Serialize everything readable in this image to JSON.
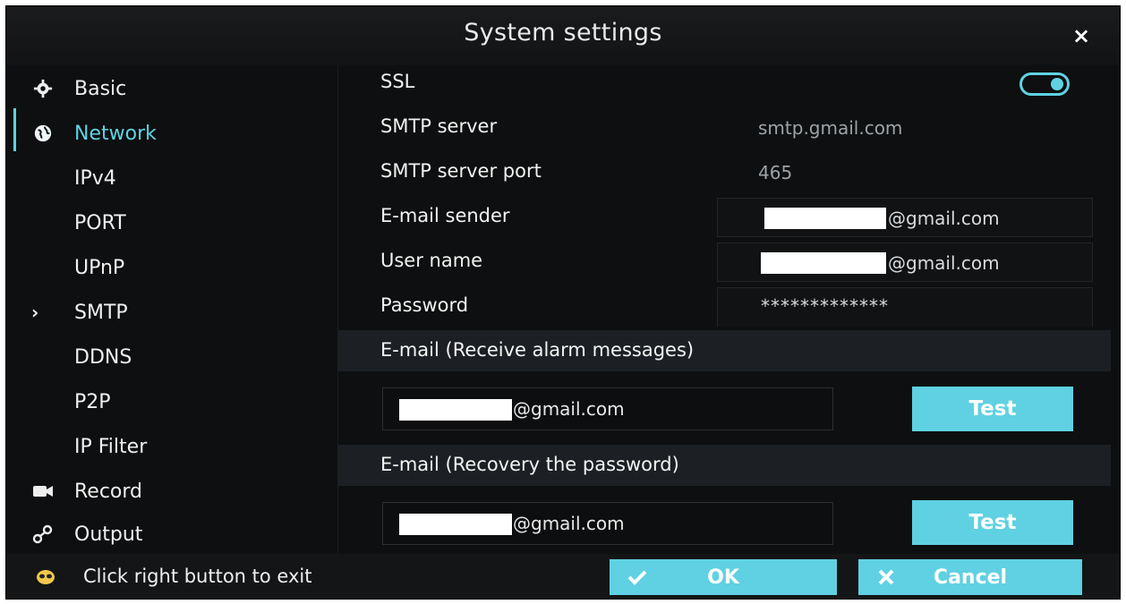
{
  "window": {
    "title": "System settings",
    "close_label": "×"
  },
  "sidebar": {
    "items": [
      {
        "label": "Basic",
        "icon": "gear-icon"
      },
      {
        "label": "Network",
        "icon": "globe-icon",
        "active": true
      },
      {
        "label": "IPv4"
      },
      {
        "label": "PORT"
      },
      {
        "label": "UPnP"
      },
      {
        "label": "SMTP",
        "selected": true
      },
      {
        "label": "DDNS"
      },
      {
        "label": "P2P"
      },
      {
        "label": "IP Filter"
      },
      {
        "label": "Record",
        "icon": "camera-icon"
      },
      {
        "label": "Output",
        "icon": "output-icon"
      }
    ]
  },
  "smtp": {
    "ssl_label": "SSL",
    "ssl_enabled": true,
    "server_label": "SMTP server",
    "server_value": "smtp.gmail.com",
    "port_label": "SMTP server port",
    "port_value": "465",
    "sender_label": "E-mail sender",
    "sender_value": "@gmail.com",
    "username_label": "User name",
    "username_value": "@gmail.com",
    "password_label": "Password",
    "password_value": "*************"
  },
  "alarm_email": {
    "section_title": "E-mail (Receive alarm messages)",
    "value": "@gmail.com",
    "test_label": "Test"
  },
  "recovery_email": {
    "section_title": "E-mail (Recovery the password)",
    "value": "@gmail.com",
    "test_label": "Test"
  },
  "footer": {
    "hint": "Click right button to exit",
    "ok_label": "OK",
    "cancel_label": "Cancel"
  },
  "colors": {
    "accent": "#5fd1e2",
    "background": "#0e0f10"
  }
}
